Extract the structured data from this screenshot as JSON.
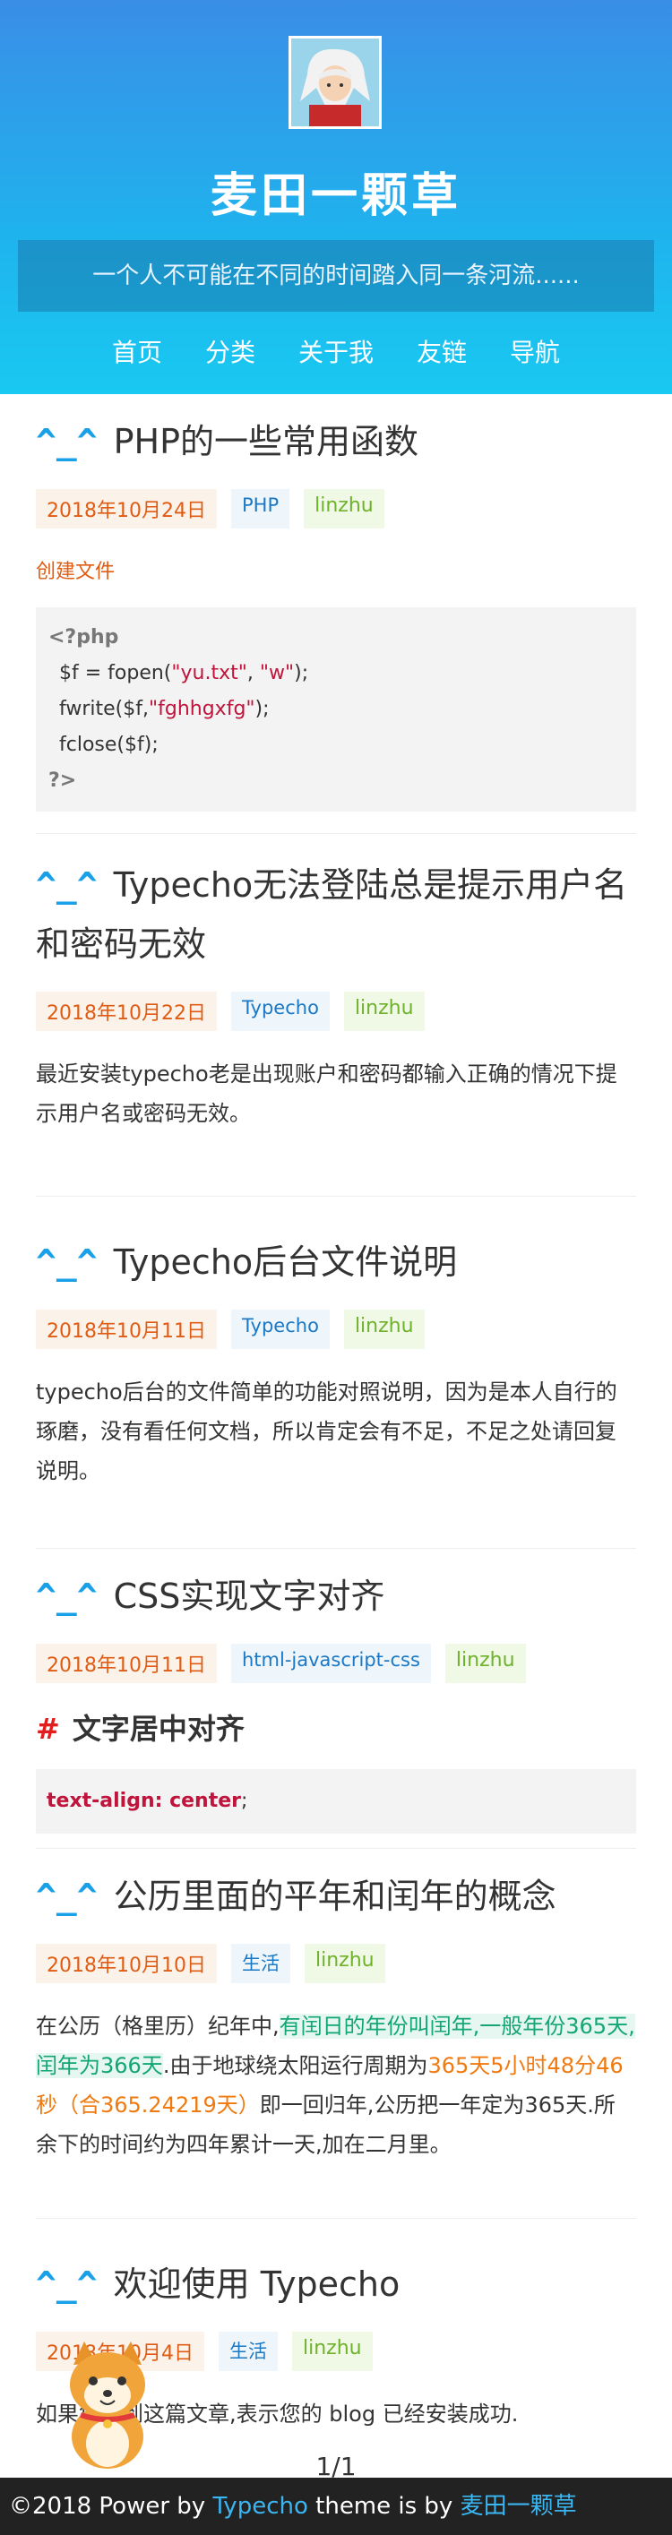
{
  "site": {
    "title": "麦田一颗草",
    "motto": "一个人不可能在不同的时间踏入同一条河流......"
  },
  "nav": [
    "首页",
    "分类",
    "关于我",
    "友链",
    "导航"
  ],
  "posts": [
    {
      "prefix": "^_^",
      "title": "PHP的一些常用函数",
      "date": "2018年10月24日",
      "category": "PHP",
      "author": "linzhu",
      "sublabel": "创建文件",
      "code": {
        "open": "<?php",
        "l1a": "$f = fopen(",
        "l1b": "\"yu.txt\"",
        "l1c": ", ",
        "l1d": "\"w\"",
        "l1e": ");",
        "l2a": "fwrite($f,",
        "l2b": "\"fghhgxfg\"",
        "l2c": ");",
        "l3": "fclose($f);",
        "close": "?>"
      }
    },
    {
      "prefix": "^_^",
      "title": "Typecho无法登陆总是提示用户名和密码无效",
      "date": "2018年10月22日",
      "category": "Typecho",
      "author": "linzhu",
      "excerpt": "最近安装typecho老是出现账户和密码都输入正确的情况下提示用户名或密码无效。"
    },
    {
      "prefix": "^_^",
      "title": "Typecho后台文件说明",
      "date": "2018年10月11日",
      "category": "Typecho",
      "author": "linzhu",
      "excerpt": "typecho后台的文件简单的功能对照说明，因为是本人自行的琢磨，没有看任何文档，所以肯定会有不足，不足之处请回复说明。"
    },
    {
      "prefix": "^_^",
      "title": "CSS实现文字对齐",
      "date": "2018年10月11日",
      "category": "html-javascript-css",
      "author": "linzhu",
      "heading_mark": "#",
      "heading": "文字居中对齐",
      "code_prop": "text-align: center",
      "code_end": ";"
    },
    {
      "prefix": "^_^",
      "title": "公历里面的平年和闰年的概念",
      "date": "2018年10月10日",
      "category": "生活",
      "author": "linzhu",
      "ex_a": "在公历（格里历）纪年中,",
      "ex_b": "有闰日的年份叫闰年,一般年份365天,闰年为366天",
      "ex_c": ".由于地球绕太阳运行周期为",
      "ex_d": "365天5小时48分46秒（合365.24219天）",
      "ex_e": "即一回归年,公历把一年定为365天.所余下的时间约为四年累计一天,加在二月里。"
    },
    {
      "prefix": "^_^",
      "title": "欢迎使用 Typecho",
      "date": "2018年10月4日",
      "category": "生活",
      "author": "linzhu",
      "excerpt": "如果您看到这篇文章,表示您的 blog 已经安装成功."
    }
  ],
  "pager": "1/1",
  "footer": {
    "a": "©2018 Power by ",
    "typecho": "Typecho",
    "b": " theme is by ",
    "author": "麦田一颗草"
  },
  "colors": {
    "header_gradient_top": "#3a8ee6",
    "header_gradient_bottom": "#19c9f0",
    "date_tag": "#e05c14",
    "category_tag": "#1b78c5",
    "author_tag": "#6fb22b",
    "footer_bg": "#222222"
  }
}
